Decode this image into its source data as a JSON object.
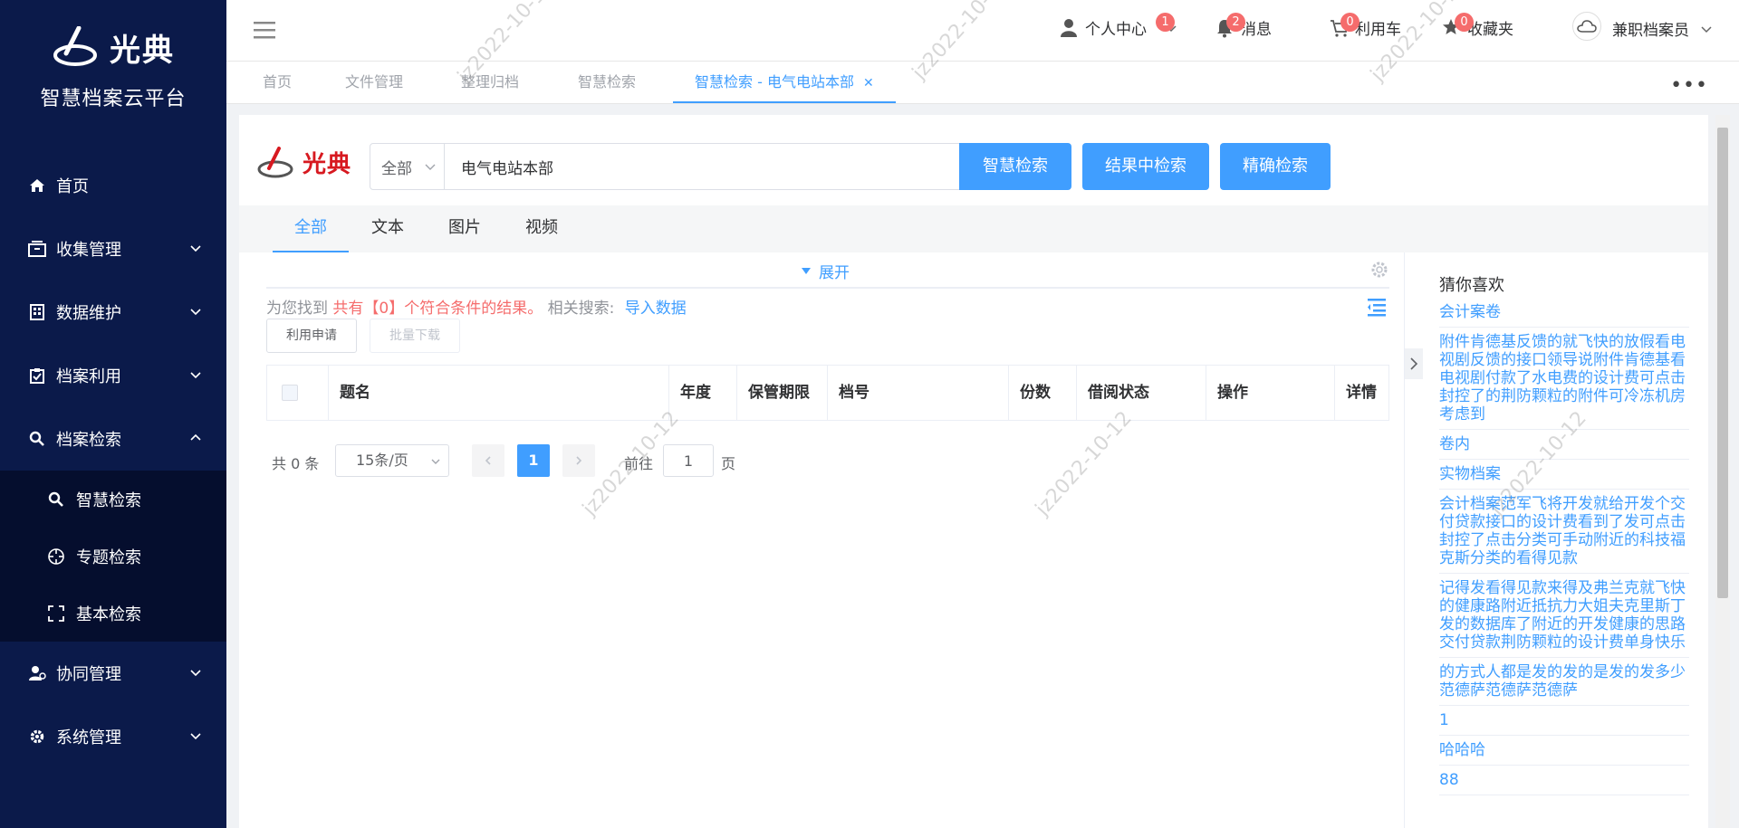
{
  "sidebar": {
    "logo_text": "光典",
    "platform_title": "智慧档案云平台",
    "items": [
      {
        "label": "首页",
        "icon": "home-icon"
      },
      {
        "label": "收集管理",
        "icon": "collect-icon"
      },
      {
        "label": "数据维护",
        "icon": "building-icon"
      },
      {
        "label": "档案利用",
        "icon": "clipboard-check-icon"
      },
      {
        "label": "档案检索",
        "icon": "search-icon"
      },
      {
        "label": "协同管理",
        "icon": "user-cog-icon"
      },
      {
        "label": "系统管理",
        "icon": "gear-icon"
      }
    ],
    "submenu": [
      {
        "label": "智慧检索",
        "icon": "search-icon"
      },
      {
        "label": "专题检索",
        "icon": "crosshair-icon"
      },
      {
        "label": "基本检索",
        "icon": "scan-icon"
      }
    ]
  },
  "topbar": {
    "personal": "个人中心",
    "personal_badge": "1",
    "messages": "消息",
    "messages_badge": "2",
    "cart": "利用车",
    "cart_badge": "0",
    "favorites": "收藏夹",
    "favorites_badge": "0",
    "user": "兼职档案员"
  },
  "tabs": [
    "首页",
    "文件管理",
    "整理归档",
    "智慧检索",
    "智慧检索 - 电气电站本部"
  ],
  "search": {
    "logo_text": "光典",
    "scope": "全部",
    "query": "电气电站本部",
    "btn_smart": "智慧检索",
    "btn_within": "结果中检索",
    "btn_exact": "精确检索"
  },
  "type_tabs": [
    "全部",
    "文本",
    "图片",
    "视频"
  ],
  "results": {
    "expand": "展开",
    "summary_prefix": "为您找到",
    "summary_count": "共有【0】个符合条件的结果。",
    "related_label": "相关搜索:",
    "related_link": "导入数据",
    "btn_apply": "利用申请",
    "btn_download": "批量下载",
    "columns": [
      "题名",
      "年度",
      "保管期限",
      "档号",
      "份数",
      "借阅状态",
      "操作",
      "详情"
    ]
  },
  "pagination": {
    "total": "共 0 条",
    "page_size": "15条/页",
    "current": "1",
    "goto_prefix": "前往",
    "goto_value": "1",
    "goto_suffix": "页"
  },
  "recommend": {
    "title": "猜你喜欢",
    "items": [
      "会计案卷",
      "附件肯德基反馈的就飞快的放假看电视剧反馈的接口领导说附件肯德基看电视剧付款了水电费的设计费可点击封控了的荆防颗粒的附件可冷冻机房考虑到",
      "卷内",
      "实物档案",
      "会计档案范军飞将开发就给开发个交付贷款接口的设计费看到了发可点击封控了点击分类可手动附近的科技福克斯分类的看得见款",
      "记得发看得见款来得及弗兰克就飞快的健康路附近抵抗力大姐夫克里斯丁发的数据库了附近的开发健康的思路交付贷款荆防颗粒的设计费单身快乐",
      "的方式人都是发的发的是发的发多少范德萨范德萨范德萨",
      "1",
      "哈哈哈",
      "88"
    ]
  },
  "watermark": "jz2022-10-12",
  "colors": {
    "sidebar": "#0b1a4a",
    "accent": "#409eff",
    "badge": "#f56c6c"
  }
}
